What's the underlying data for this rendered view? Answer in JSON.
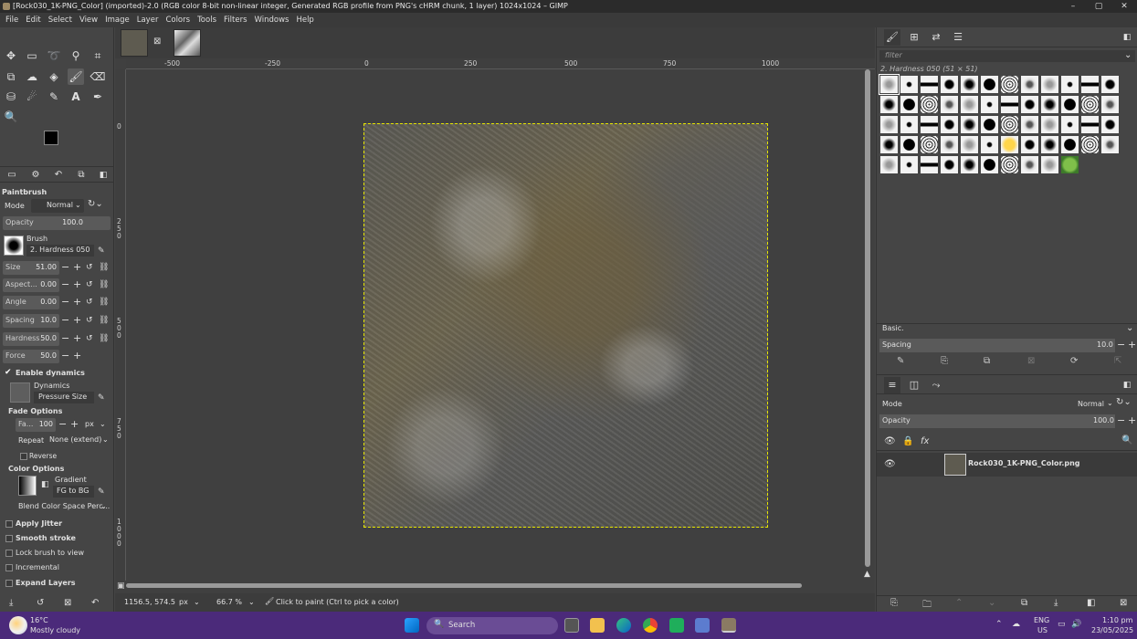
{
  "window": {
    "title": "[Rock030_1K-PNG_Color] (imported)-2.0 (RGB color 8-bit non-linear integer, Generated RGB profile from PNG's cHRM chunk, 1 layer) 1024x1024 – GIMP",
    "minimize": "–",
    "maximize": "▢",
    "close": "✕"
  },
  "menu": [
    "File",
    "Edit",
    "Select",
    "View",
    "Image",
    "Layer",
    "Colors",
    "Tools",
    "Filters",
    "Windows",
    "Help"
  ],
  "tool_options": {
    "title": "Paintbrush",
    "mode_label": "Mode",
    "mode_value": "Normal",
    "opacity_label": "Opacity",
    "opacity_value": "100.0",
    "brush_label": "Brush",
    "brush_value": "2. Hardness 050",
    "size_label": "Size",
    "size_value": "51.00",
    "aspect_label": "Aspect...",
    "aspect_value": "0.00",
    "angle_label": "Angle",
    "angle_value": "0.00",
    "spacing_label": "Spacing",
    "spacing_value": "10.0",
    "hardness_label": "Hardness",
    "hardness_value": "50.0",
    "force_label": "Force",
    "force_value": "50.0",
    "enable_dynamics": "Enable dynamics",
    "dynamics_label": "Dynamics",
    "dynamics_value": "Pressure Size",
    "fade_options": "Fade Options",
    "fade_label": "Fa...",
    "fade_value": "100",
    "fade_unit": "px",
    "repeat_label": "Repeat",
    "repeat_value": "None (extend)",
    "reverse": "Reverse",
    "color_options": "Color Options",
    "gradient_label": "Gradient",
    "gradient_value": "FG to BG",
    "blend_value": "Blend Color Space Perc...",
    "apply_jitter": "Apply Jitter",
    "smooth_stroke": "Smooth stroke",
    "lock_brush": "Lock brush to view",
    "incremental": "Incremental",
    "expand_layers": "Expand Layers"
  },
  "ruler": {
    "h_ticks": [
      "-500",
      "-250",
      "0",
      "250",
      "500",
      "750",
      "1000"
    ],
    "v_ticks": [
      "0",
      "2 5 0",
      "5 0 0",
      "7 5 0",
      "1 0 0 0"
    ]
  },
  "status": {
    "coords": "1156.5, 574.5",
    "unit": "px",
    "zoom": "66.7 %",
    "message": "Click to paint (Ctrl to pick a color)"
  },
  "brushes": {
    "filter_placeholder": "filter",
    "selected": "2. Hardness 050 (51 × 51)",
    "preset": "Basic.",
    "spacing_label": "Spacing",
    "spacing_value": "10.0"
  },
  "layers": {
    "mode_label": "Mode",
    "mode_value": "Normal",
    "opacity_label": "Opacity",
    "opacity_value": "100.0",
    "layer_name": "Rock030_1K-PNG_Color.png"
  },
  "taskbar": {
    "weather_temp": "16°C",
    "weather_desc": "Mostly cloudy",
    "search": "Search",
    "lang": "ENG",
    "region": "US",
    "time": "1:10 pm",
    "date": "23/05/2025"
  },
  "colors": {
    "titlebar": "#2b2b2b",
    "panel": "#454545",
    "selection": "#e6e600",
    "taskbar": "#4b2a7a"
  }
}
